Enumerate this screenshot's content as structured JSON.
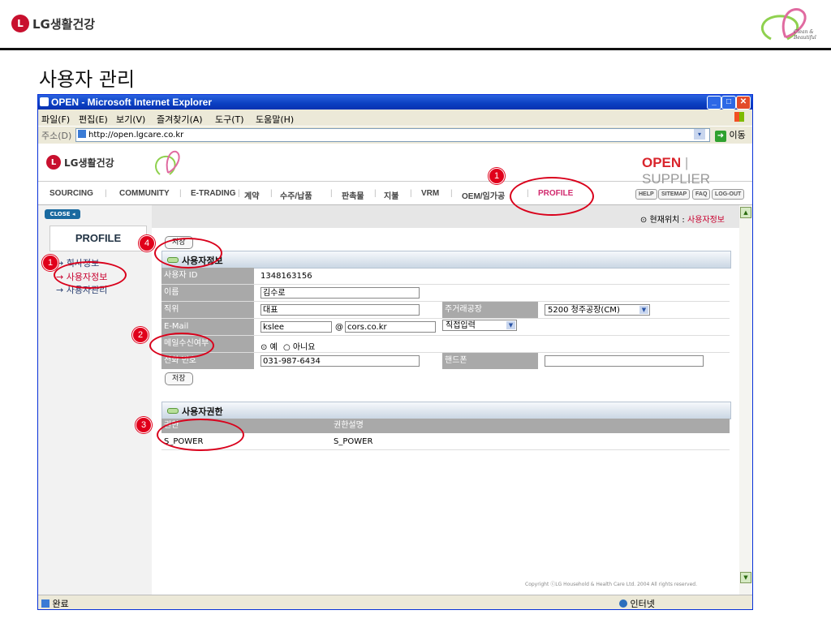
{
  "slide": {
    "brand": "LG생활건강",
    "brand_mark": "L",
    "title": "사용자 관리",
    "tagline": "Clean & Beautiful"
  },
  "window": {
    "title": "OPEN - Microsoft Internet Explorer",
    "menu": [
      "파일(F)",
      "편집(E)",
      "보기(V)",
      "즐겨찾기(A)",
      "도구(T)",
      "도움말(H)"
    ],
    "address_label": "주소(D)",
    "address_value": "http://open.lgcare.co.kr",
    "go_label": "이동",
    "status_text": "완료",
    "zone_text": "인터넷"
  },
  "site": {
    "brand": "LG생활건강",
    "logo_word_open": "OPEN",
    "logo_word_supplier": "SUPPLIER",
    "nav": [
      "SOURCING",
      "COMMUNITY",
      "E-TRADING",
      "계약",
      "수주/납품",
      "판촉물",
      "지불",
      "VRM",
      "OEM/임가공",
      "PROFILE"
    ],
    "nav_active": "PROFILE",
    "util": [
      "HELP",
      "SITEMAP",
      "FAQ",
      "LOG-OUT"
    ],
    "close_label": "CLOSE",
    "sidebar_title": "PROFILE",
    "sidebar_items": [
      "회사정보",
      "사용자정보",
      "사용자관리"
    ],
    "location_label": "현재위치 :",
    "location_value": "사용자정보",
    "save_label": "저장",
    "section_user": "사용자정보",
    "fields": {
      "user_id_label": "사용자 ID",
      "user_id_value": "1348163156",
      "name_label": "이름",
      "name_value": "김수로",
      "position_label": "직위",
      "position_value": "대표",
      "plant_label": "주거래공장",
      "plant_value": "5200 청주공장(CM)",
      "email_label": "E-Mail",
      "email_user": "kslee",
      "email_at": "@",
      "email_domain": "cors.co.kr",
      "email_select": "직접입력",
      "mail_label": "메일수신여부",
      "mail_yes": "예",
      "mail_no": "아니요",
      "mail_selected": "예",
      "phone_label": "전화 번호",
      "phone_value": "031-987-6434",
      "mobile_label": "핸드폰",
      "mobile_value": ""
    },
    "section_auth": "사용자권한",
    "auth_headers": [
      "권한",
      "권한설명"
    ],
    "auth_rows": [
      [
        "S_POWER",
        "S_POWER"
      ]
    ],
    "copyright": "Copyright ⓒLG Household & Health Care Ltd. 2004 All rights reserved."
  },
  "annotations": [
    "1",
    "1",
    "2",
    "3",
    "4"
  ],
  "colors": {
    "accent": "#c8102e",
    "annotation": "#e0001b",
    "label_bg": "#a9a9a9",
    "titlebar": "#0a3fc1"
  }
}
